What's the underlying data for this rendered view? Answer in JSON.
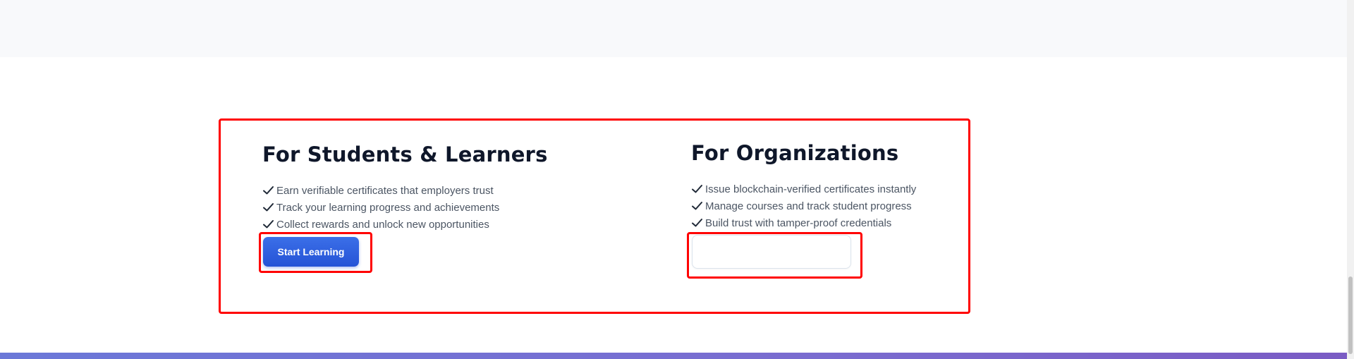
{
  "students": {
    "title": "For Students & Learners",
    "features": [
      "Earn verifiable certificates that employers trust",
      "Track your learning progress and achievements",
      "Collect rewards and unlock new opportunities"
    ],
    "cta_label": "Start Learning"
  },
  "organizations": {
    "title": "For Organizations",
    "features": [
      "Issue blockchain-verified certificates instantly",
      "Manage courses and track student progress",
      "Build trust with tamper-proof credentials"
    ],
    "cta_label": ""
  },
  "icons": {
    "feature_bullet": "checkmark-icon"
  },
  "colors": {
    "heading": "#0f172a",
    "body_text": "#4b5563",
    "primary_button": "#2f5fe0",
    "highlight_outline": "#ff0000",
    "footer_gradient_start": "#6b78d8",
    "footer_gradient_end": "#7a5bc4"
  }
}
